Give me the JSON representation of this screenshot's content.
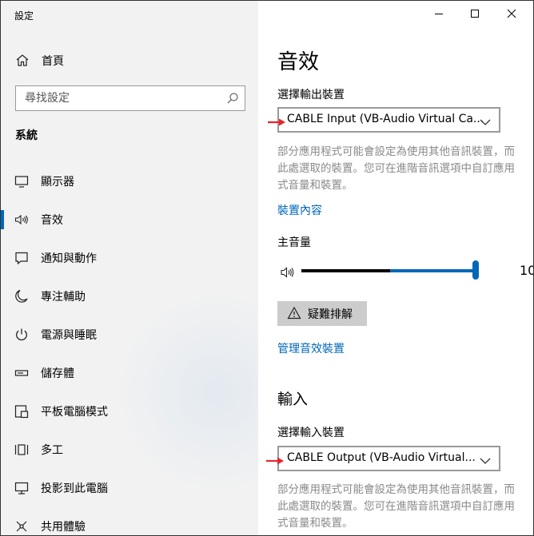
{
  "window": {
    "title": "設定"
  },
  "sidebar": {
    "home_label": "首頁",
    "search_placeholder": "尋找設定",
    "section_title": "系統",
    "items": [
      {
        "label": "顯示器",
        "icon": "monitor-icon"
      },
      {
        "label": "音效",
        "icon": "speaker-icon",
        "active": true
      },
      {
        "label": "通知與動作",
        "icon": "notification-icon"
      },
      {
        "label": "專注輔助",
        "icon": "moon-icon"
      },
      {
        "label": "電源與睡眠",
        "icon": "power-icon"
      },
      {
        "label": "儲存體",
        "icon": "storage-icon"
      },
      {
        "label": "平板電腦模式",
        "icon": "tablet-icon"
      },
      {
        "label": "多工",
        "icon": "multitask-icon"
      },
      {
        "label": "投影到此電腦",
        "icon": "project-icon"
      },
      {
        "label": "共用體驗",
        "icon": "shared-icon"
      }
    ]
  },
  "main": {
    "title": "音效",
    "output": {
      "label": "選擇輸出裝置",
      "device": "CABLE Input (VB-Audio Virtual Ca...",
      "desc_line1": "部分應用程式可能會設定為使用其他音訊裝置，而",
      "desc_line2": "此處選取的裝置。您可在進階音訊選項中自訂應用",
      "desc_line3": "式音量和裝置。",
      "properties_link": "裝置內容",
      "master_volume_label": "主音量",
      "volume": 100,
      "volume_text": "10",
      "troubleshoot_label": "疑難排解",
      "manage_link": "管理音效裝置"
    },
    "input": {
      "section_title": "輸入",
      "label": "選擇輸入裝置",
      "device": "CABLE Output (VB-Audio Virtual...",
      "desc_line1": "部分應用程式可能會設定為使用其他音訊裝置，而",
      "desc_line2": "此處選取的裝置。您可在進階音訊選項中自訂應用",
      "desc_line3": "式音量和裝置。"
    }
  },
  "colors": {
    "accent": "#0067b8",
    "arrow": "#e8242a",
    "sidebar_bg": "#f2f2f2"
  }
}
